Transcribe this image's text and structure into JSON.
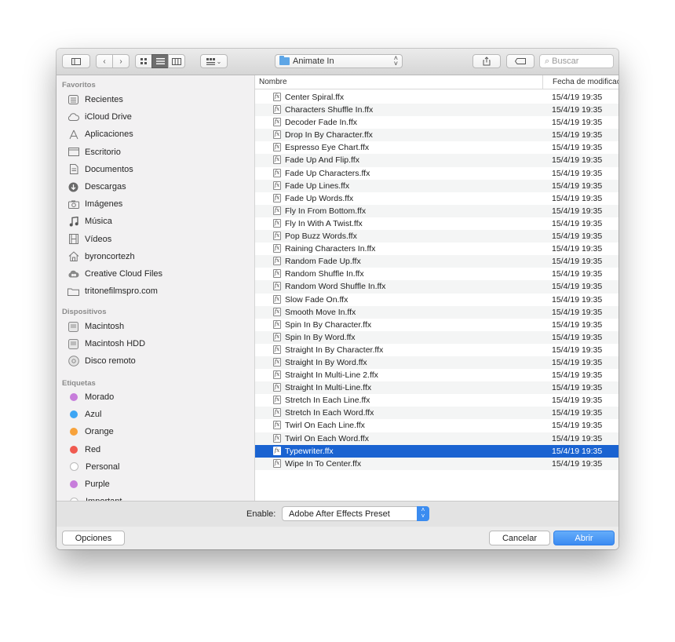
{
  "toolbar": {
    "path_label": "Animate In",
    "search_placeholder": "Buscar"
  },
  "sidebar": {
    "favorites_header": "Favoritos",
    "favorites": [
      {
        "label": "Recientes",
        "icon": "recents-icon"
      },
      {
        "label": "iCloud Drive",
        "icon": "cloud-icon"
      },
      {
        "label": "Aplicaciones",
        "icon": "applications-icon"
      },
      {
        "label": "Escritorio",
        "icon": "desktop-icon"
      },
      {
        "label": "Documentos",
        "icon": "documents-icon"
      },
      {
        "label": "Descargas",
        "icon": "downloads-icon"
      },
      {
        "label": "Imágenes",
        "icon": "camera-icon"
      },
      {
        "label": "Música",
        "icon": "music-icon"
      },
      {
        "label": "Vídeos",
        "icon": "film-icon"
      },
      {
        "label": "byroncortezh",
        "icon": "home-icon"
      },
      {
        "label": "Creative Cloud Files",
        "icon": "creative-cloud-icon"
      },
      {
        "label": "tritonefilmspro.com",
        "icon": "folder-icon"
      }
    ],
    "devices_header": "Dispositivos",
    "devices": [
      {
        "label": "Macintosh",
        "icon": "disk-icon"
      },
      {
        "label": "Macintosh HDD",
        "icon": "disk-icon"
      },
      {
        "label": "Disco remoto",
        "icon": "remote-disc-icon"
      }
    ],
    "tags_header": "Etiquetas",
    "tags": [
      {
        "label": "Morado",
        "color": "#c77ddb"
      },
      {
        "label": "Azul",
        "color": "#3da5f4"
      },
      {
        "label": "Orange",
        "color": "#f7a23b"
      },
      {
        "label": "Red",
        "color": "#f05a50"
      },
      {
        "label": "Personal",
        "color": "#ffffff"
      },
      {
        "label": "Purple",
        "color": "#c77ddb"
      },
      {
        "label": "Important",
        "color": "#ffffff"
      }
    ]
  },
  "list": {
    "col_name": "Nombre",
    "col_date": "Fecha de modificac",
    "selected_index": 28,
    "files": [
      {
        "name": "Center Spiral.ffx",
        "date": "15/4/19 19:35"
      },
      {
        "name": "Characters Shuffle In.ffx",
        "date": "15/4/19 19:35"
      },
      {
        "name": "Decoder Fade In.ffx",
        "date": "15/4/19 19:35"
      },
      {
        "name": "Drop In By Character.ffx",
        "date": "15/4/19 19:35"
      },
      {
        "name": "Espresso Eye Chart.ffx",
        "date": "15/4/19 19:35"
      },
      {
        "name": "Fade Up And Flip.ffx",
        "date": "15/4/19 19:35"
      },
      {
        "name": "Fade Up Characters.ffx",
        "date": "15/4/19 19:35"
      },
      {
        "name": "Fade Up Lines.ffx",
        "date": "15/4/19 19:35"
      },
      {
        "name": "Fade Up Words.ffx",
        "date": "15/4/19 19:35"
      },
      {
        "name": "Fly In From Bottom.ffx",
        "date": "15/4/19 19:35"
      },
      {
        "name": "Fly In With A Twist.ffx",
        "date": "15/4/19 19:35"
      },
      {
        "name": "Pop Buzz Words.ffx",
        "date": "15/4/19 19:35"
      },
      {
        "name": "Raining Characters In.ffx",
        "date": "15/4/19 19:35"
      },
      {
        "name": "Random Fade Up.ffx",
        "date": "15/4/19 19:35"
      },
      {
        "name": "Random Shuffle In.ffx",
        "date": "15/4/19 19:35"
      },
      {
        "name": "Random Word Shuffle In.ffx",
        "date": "15/4/19 19:35"
      },
      {
        "name": "Slow Fade On.ffx",
        "date": "15/4/19 19:35"
      },
      {
        "name": "Smooth Move In.ffx",
        "date": "15/4/19 19:35"
      },
      {
        "name": "Spin In By Character.ffx",
        "date": "15/4/19 19:35"
      },
      {
        "name": "Spin In By Word.ffx",
        "date": "15/4/19 19:35"
      },
      {
        "name": "Straight In By Character.ffx",
        "date": "15/4/19 19:35"
      },
      {
        "name": "Straight In By Word.ffx",
        "date": "15/4/19 19:35"
      },
      {
        "name": "Straight In Multi-Line 2.ffx",
        "date": "15/4/19 19:35"
      },
      {
        "name": "Straight In Multi-Line.ffx",
        "date": "15/4/19 19:35"
      },
      {
        "name": "Stretch In Each Line.ffx",
        "date": "15/4/19 19:35"
      },
      {
        "name": "Stretch In Each Word.ffx",
        "date": "15/4/19 19:35"
      },
      {
        "name": "Twirl On Each Line.ffx",
        "date": "15/4/19 19:35"
      },
      {
        "name": "Twirl On Each Word.ffx",
        "date": "15/4/19 19:35"
      },
      {
        "name": "Typewriter.ffx",
        "date": "15/4/19 19:35"
      },
      {
        "name": "Wipe In To Center.ffx",
        "date": "15/4/19 19:35"
      }
    ]
  },
  "footer": {
    "enable_label": "Enable:",
    "enable_value": "Adobe After Effects Preset",
    "options_label": "Opciones",
    "cancel_label": "Cancelar",
    "open_label": "Abrir"
  },
  "colors": {
    "selection": "#1a63d1",
    "primary_button": "#3b8bf2"
  }
}
